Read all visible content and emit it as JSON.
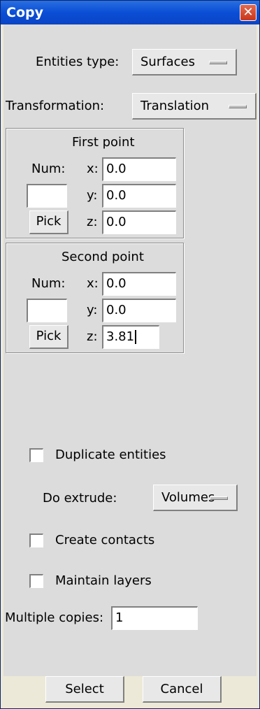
{
  "window": {
    "title": "Copy",
    "close_glyph": "✕"
  },
  "entities_type": {
    "label": "Entities type:",
    "value": "Surfaces"
  },
  "transformation": {
    "label": "Transformation:",
    "value": "Translation"
  },
  "first_point": {
    "title": "First point",
    "num_label": "Num:",
    "num_value": "",
    "x_label": "x:",
    "x_value": "0.0",
    "y_label": "y:",
    "y_value": "0.0",
    "z_label": "z:",
    "z_value": "0.0",
    "pick_label": "Pick"
  },
  "second_point": {
    "title": "Second point",
    "num_label": "Num:",
    "num_value": "",
    "x_label": "x:",
    "x_value": "0.0",
    "y_label": "y:",
    "y_value": "0.0",
    "z_label": "z:",
    "z_value": "3.81",
    "pick_label": "Pick"
  },
  "duplicate_entities": {
    "label": "Duplicate entities",
    "checked": false
  },
  "do_extrude": {
    "label": "Do extrude:",
    "value": "Volumes"
  },
  "create_contacts": {
    "label": "Create contacts",
    "checked": false
  },
  "maintain_layers": {
    "label": "Maintain layers",
    "checked": false
  },
  "multiple_copies": {
    "label": "Multiple copies:",
    "value": "1"
  },
  "footer": {
    "select_label": "Select",
    "cancel_label": "Cancel"
  }
}
